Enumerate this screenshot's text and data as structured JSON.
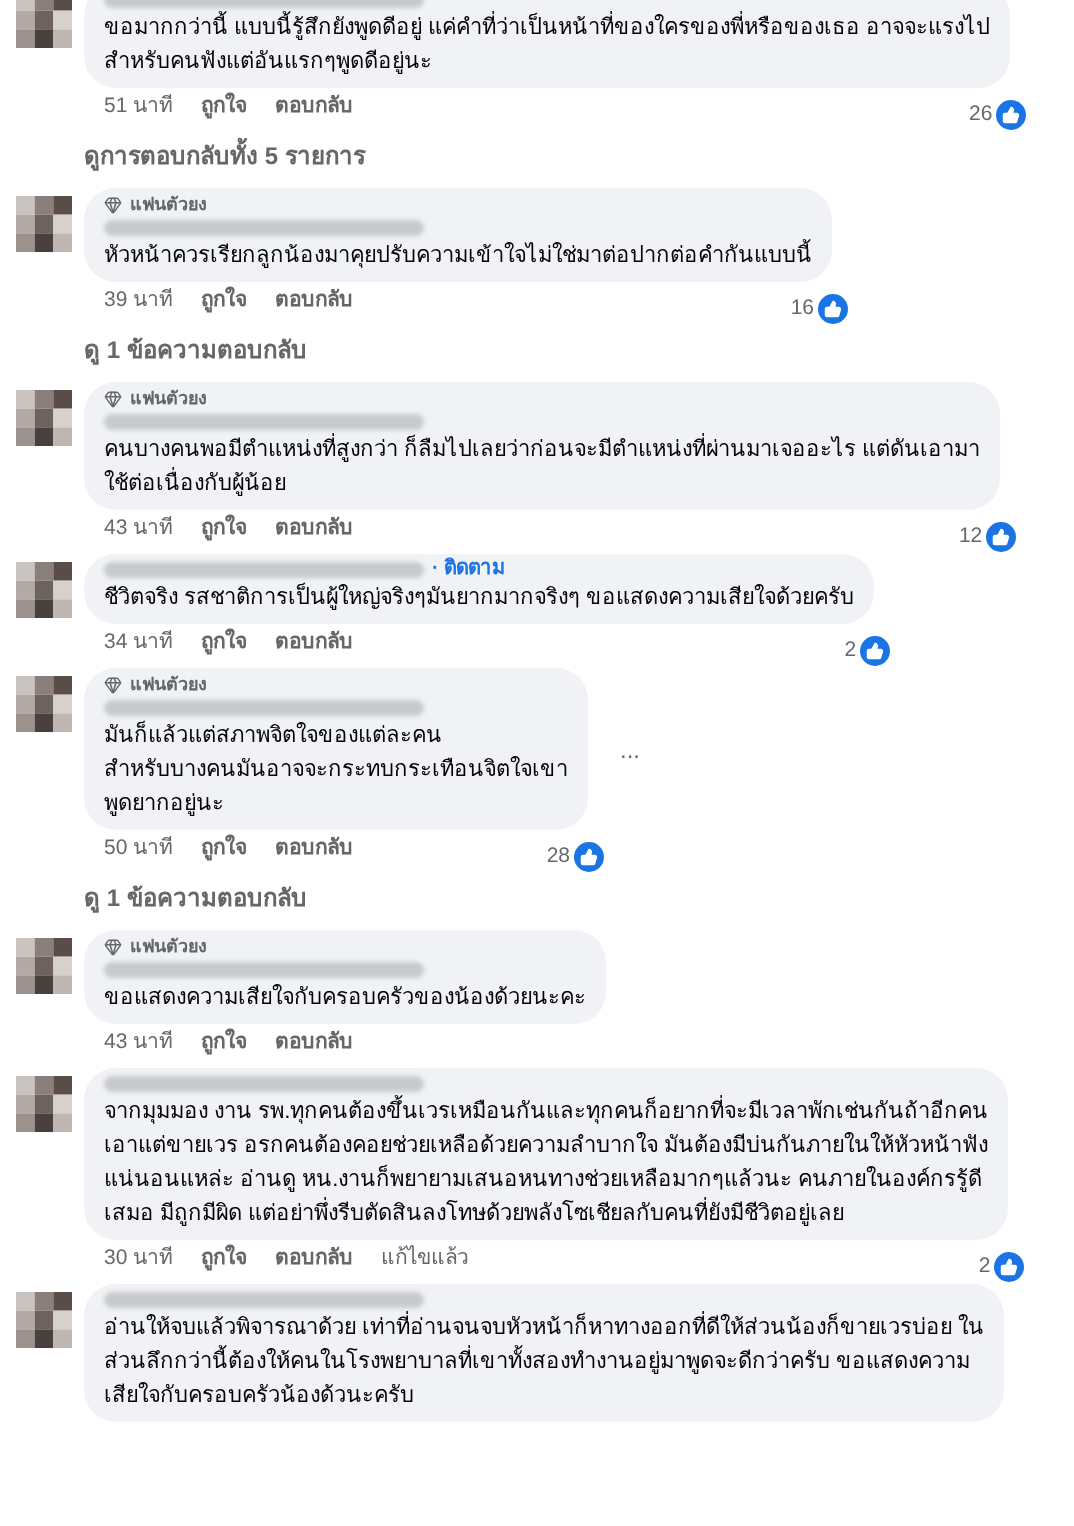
{
  "items": [
    {
      "kind": "comment",
      "lines": [
        "ขอมากกว่านี้ แบบนี้รู้สึกยังพูดดีอยู่ แค่คำที่ว่าเป็นหน้าที่ของใครของพี่หรือของเธอ อาจจะแรงไป",
        "สำหรับคนฟังแต่อันแรกๆพูดดีอยู่นะ"
      ],
      "time": "51 นาที",
      "like": "ถูกใจ",
      "reply": "ตอบกลับ",
      "likes": "26"
    },
    {
      "kind": "more",
      "text": "ดูการตอบกลับทั้ง 5 รายการ"
    },
    {
      "kind": "comment",
      "badge": "แฟนตัวยง",
      "lines": [
        "หัวหน้าควรเรียกลูกน้องมาคุยปรับความเข้าใจไม่ใช่มาต่อปากต่อคำกันแบบนี้"
      ],
      "time": "39 นาที",
      "like": "ถูกใจ",
      "reply": "ตอบกลับ",
      "likes": "16"
    },
    {
      "kind": "more",
      "text": "ดู 1 ข้อความตอบกลับ"
    },
    {
      "kind": "comment",
      "badge": "แฟนตัวยง",
      "lines": [
        "คนบางคนพอมีตำแหน่งที่สูงกว่า ก็ลืมไปเลยว่าก่อนจะมีตำแหน่งที่ผ่านมาเจออะไร แต่ดันเอามา",
        "ใช้ต่อเนื่องกับผู้น้อย"
      ],
      "time": "43 นาที",
      "like": "ถูกใจ",
      "reply": "ตอบกลับ",
      "likes": "12"
    },
    {
      "kind": "comment",
      "follow": "· ติดตาม",
      "lines": [
        "ชีวิตจริง รสชาติการเป็นผู้ใหญ่จริงๆมันยากมากจริงๆ ขอแสดงความเสียใจด้วยครับ"
      ],
      "time": "34 นาที",
      "like": "ถูกใจ",
      "reply": "ตอบกลับ",
      "likes": "2"
    },
    {
      "kind": "comment",
      "badge": "แฟนตัวยง",
      "lines": [
        "มันก็แล้วแต่สภาพจิตใจของแต่ละคน",
        "สำหรับบางคนมันอาจจะกระทบกระเทือนจิตใจเขา",
        "พูดยากอยู่นะ"
      ],
      "time": "50 นาที",
      "like": "ถูกใจ",
      "reply": "ตอบกลับ",
      "likes": "28",
      "more_menu": "..."
    },
    {
      "kind": "more",
      "text": "ดู 1 ข้อความตอบกลับ"
    },
    {
      "kind": "comment",
      "badge": "แฟนตัวยง",
      "lines": [
        "ขอแสดงความเสียใจกับครอบครัวของน้องด้วยนะคะ"
      ],
      "time": "43 นาที",
      "like": "ถูกใจ",
      "reply": "ตอบกลับ"
    },
    {
      "kind": "comment",
      "lines": [
        "จากมุมมอง งาน รพ.ทุกคนต้องขึ้นเวรเหมือนกันและทุกคนก็อยากที่จะมีเวลาพักเช่นกันถ้าอีกคน",
        "เอาแต่ขายเวร อรกคนต้องคอยช่วยเหลือด้วยความลำบากใจ มันต้องมีบ่นกันภายในให้หัวหน้าฟัง",
        "แน่นอนแหล่ะ อ่านดู หน.งานก็พยายามเสนอหนทางช่วยเหลือมากๆแล้วนะ คนภายในองค์กรรู้ดี",
        "เสมอ มีถูกมีผิด แต่อย่าพึ่งรีบตัดสินลงโทษด้วยพลังโซเชียลกับคนที่ยังมีชีวิตอยู่เลย"
      ],
      "time": "30 นาที",
      "like": "ถูกใจ",
      "reply": "ตอบกลับ",
      "edited": "แก้ไขแล้ว",
      "likes": "2"
    },
    {
      "kind": "comment",
      "lines": [
        "อ่านให้จบแล้วพิจารณาด้วย เท่าที่อ่านจนจบหัวหน้าก็หาทางออกที่ดีให้ส่วนน้องก็ขายเวรบ่อย ใน",
        "ส่วนลึกกว่านี้ต้องให้คนในโรงพยาบาลที่เขาทั้งสองทำงานอยู่มาพูดจะดีกว่าครับ ขอแสดงความ",
        "เสียใจกับครอบครัวน้องด้วนะครับ"
      ]
    }
  ]
}
